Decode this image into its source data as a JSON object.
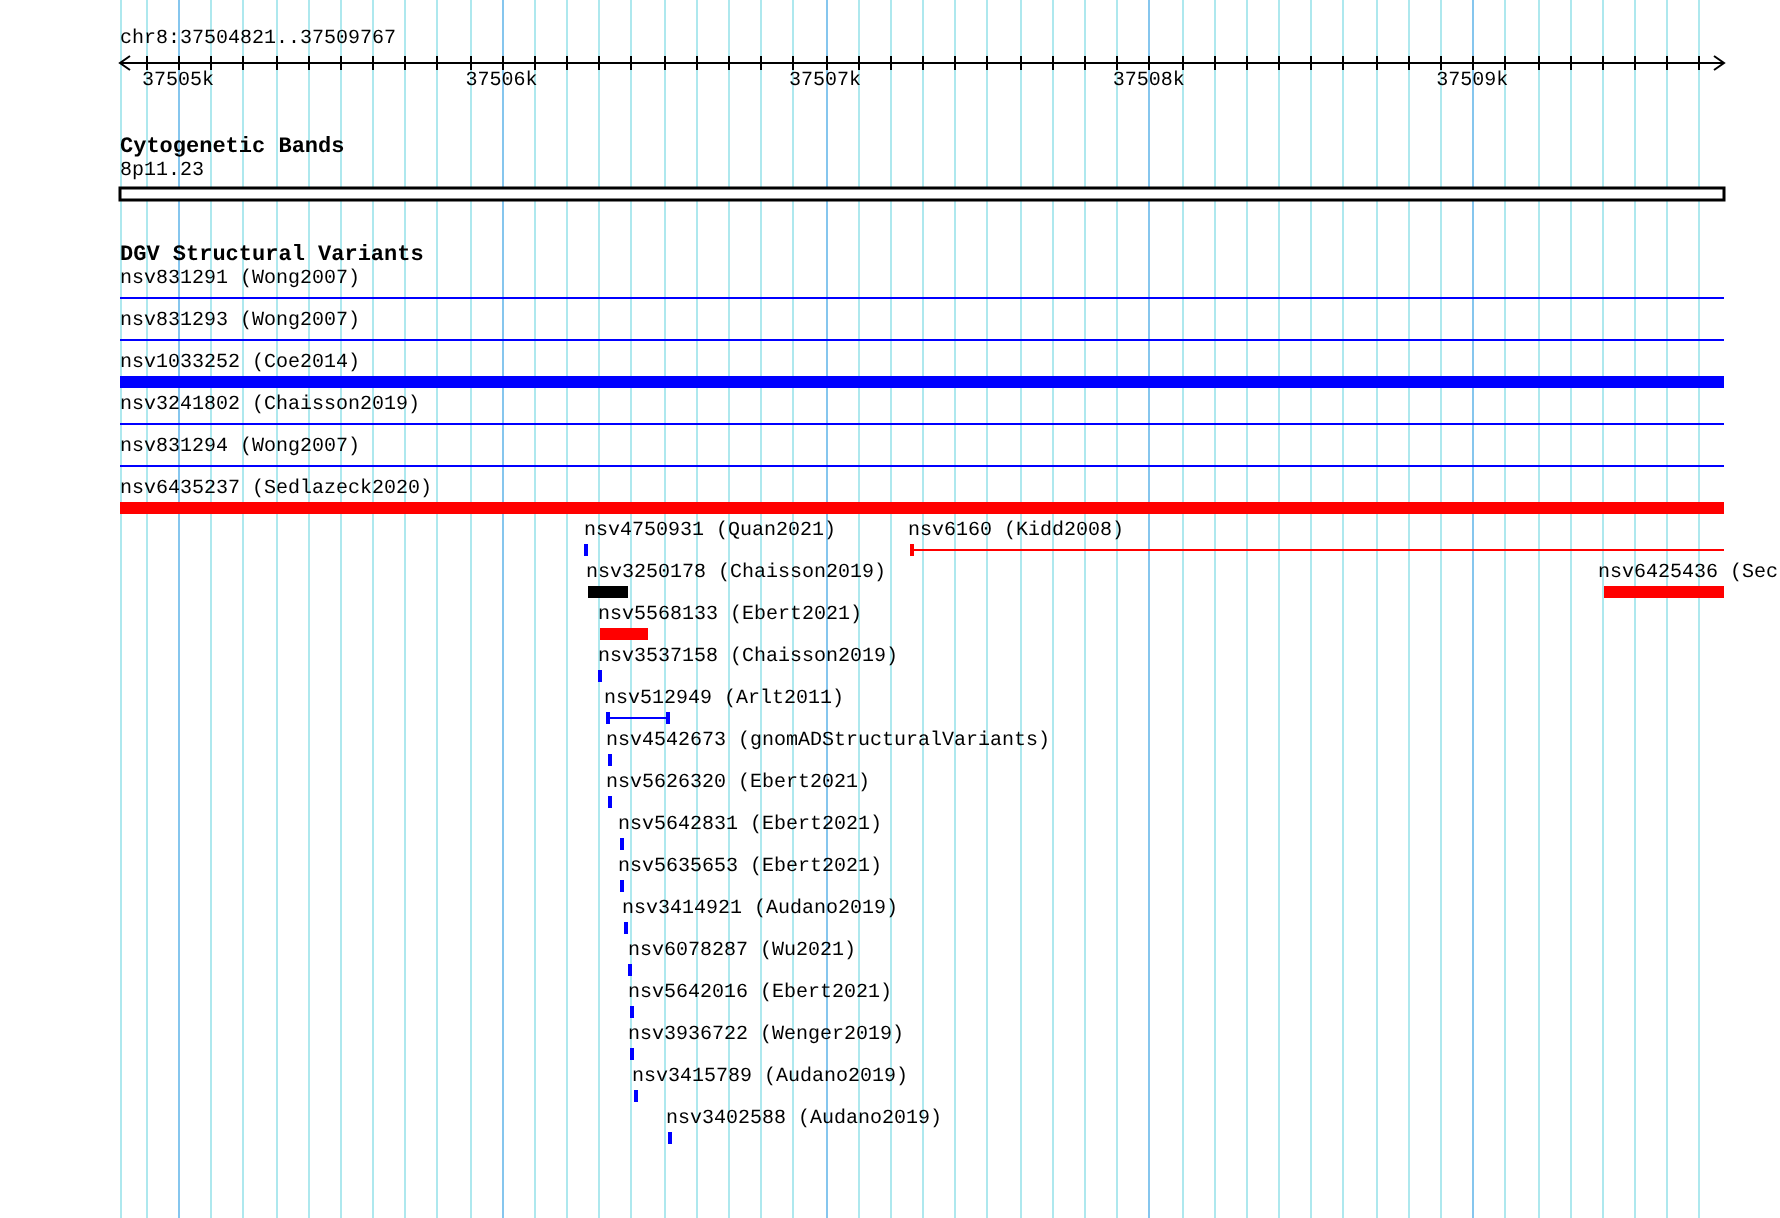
{
  "ruler": {
    "region": "chr8:37504821..37509767",
    "tick_labels": [
      "37505k",
      "37506k",
      "37507k",
      "37508k",
      "37509k"
    ]
  },
  "tracks": [
    {
      "title": "Cytogenetic Bands",
      "features": [
        {
          "label": "8p11.23",
          "kind": "band"
        }
      ]
    },
    {
      "title": "DGV Structural Variants",
      "features": [
        {
          "label": "nsv831291 (Wong2007)",
          "kind": "span",
          "color": "#0000ff"
        },
        {
          "label": "nsv831293 (Wong2007)",
          "kind": "span",
          "color": "#0000ff"
        },
        {
          "label": "nsv1033252 (Coe2014)",
          "kind": "bar",
          "color": "#0000ff"
        },
        {
          "label": "nsv3241802 (Chaisson2019)",
          "kind": "span",
          "color": "#0000ff"
        },
        {
          "label": "nsv831294 (Wong2007)",
          "kind": "span",
          "color": "#0000ff"
        },
        {
          "label": "nsv6435237 (Sedlazeck2020)",
          "kind": "bar",
          "color": "#ff0000"
        },
        {
          "label": "nsv4750931 (Quan2021)",
          "kind": "bar",
          "color": "#0000ff"
        },
        {
          "label": "nsv6160 (Kidd2008)",
          "kind": "span",
          "color": "#ff0000"
        },
        {
          "label": "nsv3250178 (Chaisson2019)",
          "kind": "bar",
          "color": "#000000"
        },
        {
          "label": "nsv6425436 (Sec",
          "kind": "bar",
          "color": "#ff0000"
        },
        {
          "label": "nsv5568133 (Ebert2021)",
          "kind": "bar",
          "color": "#ff0000"
        },
        {
          "label": "nsv3537158 (Chaisson2019)",
          "kind": "bar",
          "color": "#0000ff"
        },
        {
          "label": "nsv512949 (Arlt2011)",
          "kind": "span",
          "color": "#0000ff"
        },
        {
          "label": "nsv4542673 (gnomADStructuralVariants)",
          "kind": "bar",
          "color": "#0000ff"
        },
        {
          "label": "nsv5626320 (Ebert2021)",
          "kind": "bar",
          "color": "#0000ff"
        },
        {
          "label": "nsv5642831 (Ebert2021)",
          "kind": "bar",
          "color": "#0000ff"
        },
        {
          "label": "nsv5635653 (Ebert2021)",
          "kind": "bar",
          "color": "#0000ff"
        },
        {
          "label": "nsv3414921 (Audano2019)",
          "kind": "bar",
          "color": "#0000ff"
        },
        {
          "label": "nsv6078287 (Wu2021)",
          "kind": "bar",
          "color": "#0000ff"
        },
        {
          "label": "nsv5642016 (Ebert2021)",
          "kind": "bar",
          "color": "#0000ff"
        },
        {
          "label": "nsv3936722 (Wenger2019)",
          "kind": "bar",
          "color": "#0000ff"
        },
        {
          "label": "nsv3415789 (Audano2019)",
          "kind": "bar",
          "color": "#0000ff"
        },
        {
          "label": "nsv3402588 (Audano2019)",
          "kind": "bar",
          "color": "#0000ff"
        }
      ]
    }
  ]
}
